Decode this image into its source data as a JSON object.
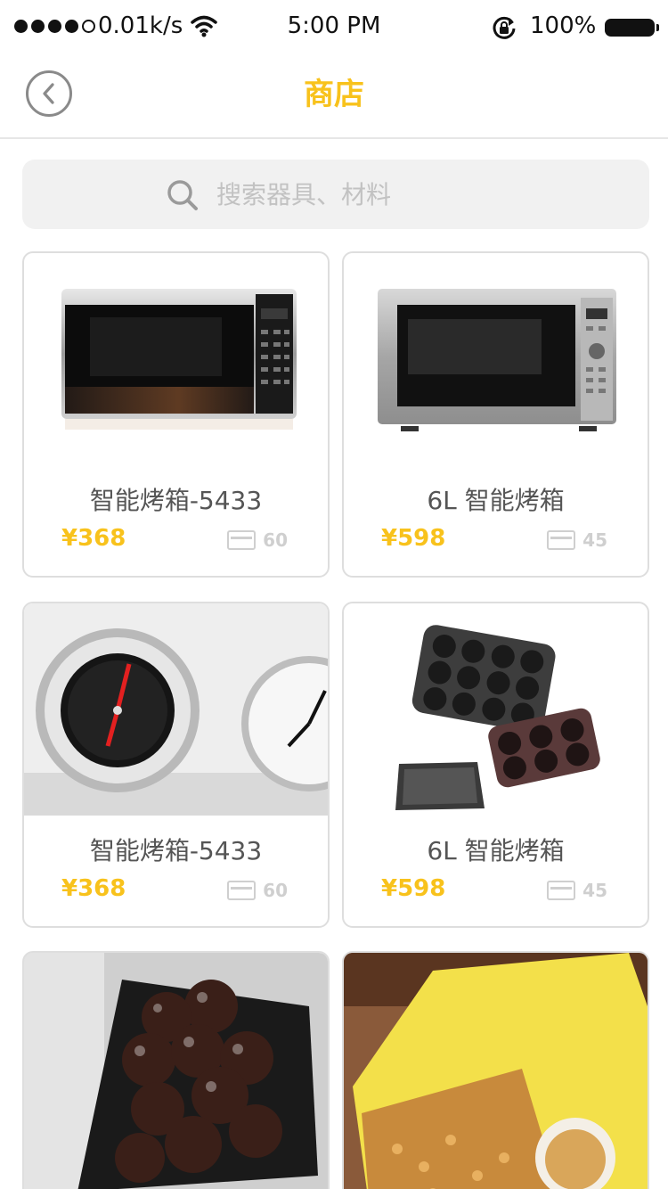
{
  "status_bar": {
    "network_speed": "0.01k/s",
    "time": "5:00 PM",
    "battery": "100%"
  },
  "nav": {
    "title": "商店",
    "back_icon": "chevron-left-circle-icon"
  },
  "search": {
    "placeholder": "搜索器具、材料",
    "icon": "search-icon"
  },
  "colors": {
    "accent": "#f8c21c",
    "price": "#f8c21c",
    "muted": "#cfcfcf"
  },
  "products": [
    {
      "name": "智能烤箱-5433",
      "price": "¥368",
      "count": "60",
      "image": "black-microwave-oven"
    },
    {
      "name": "6L 智能烤箱",
      "price": "¥598",
      "count": "45",
      "image": "silver-microwave-oven"
    },
    {
      "name": "智能烤箱-5433",
      "price": "¥368",
      "count": "60",
      "image": "oven-thermometers"
    },
    {
      "name": "6L 智能烤箱",
      "price": "¥598",
      "count": "45",
      "image": "muffin-baking-pans"
    },
    {
      "image": "chocolate-balls-in-bowl"
    },
    {
      "image": "chopped-peanuts-bag"
    }
  ]
}
